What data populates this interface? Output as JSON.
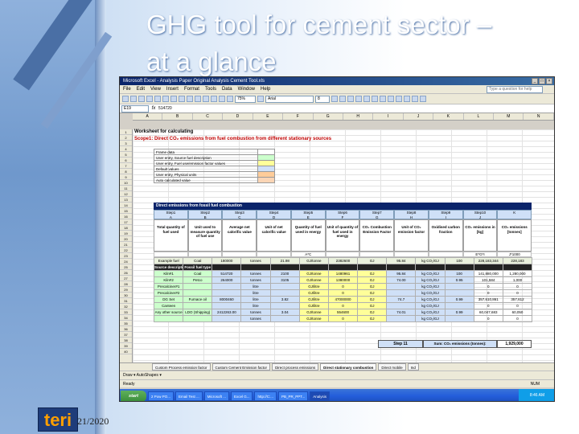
{
  "slide": {
    "title_line1": "GHG tool for cement sector –",
    "title_line2": "at a glance",
    "date": "21/2020",
    "logo_text": "teri"
  },
  "excel": {
    "window_title": "Microsoft Excel - Analysis Paper Original Analysis Cement Tool.xls",
    "menu": [
      "File",
      "Edit",
      "View",
      "Insert",
      "Format",
      "Tools",
      "Data",
      "Window",
      "Help"
    ],
    "help_placeholder": "Type a question for help",
    "zoom": "75%",
    "font": "Arial",
    "font_size": "8",
    "name_box": "E19",
    "formula_value": "514720",
    "columns": [
      "A",
      "B",
      "C",
      "D",
      "E",
      "F",
      "G",
      "H",
      "I",
      "J",
      "K",
      "L",
      "M",
      "N"
    ],
    "rows": [
      "1",
      "2",
      "3",
      "4",
      "5",
      "6",
      "7",
      "8",
      "9",
      "10",
      "11",
      "12",
      "13",
      "14",
      "15",
      "16",
      "17",
      "18",
      "19",
      "20",
      "21",
      "22",
      "23",
      "24",
      "25",
      "26",
      "27",
      "28",
      "29",
      "30",
      "31",
      "32",
      "33",
      "34",
      "35",
      "36",
      "37",
      "38",
      "39",
      "40"
    ],
    "worksheet_title": "Worksheet for calculating",
    "scope_title": "Scope1: Direct CO₂ emissions from fuel combustion from different stationary sources",
    "legend": [
      {
        "label": "Frame data",
        "color": "#ffffff"
      },
      {
        "label": "User entry, Source fuel description",
        "color": "#ccffcc"
      },
      {
        "label": "User entry, Fuel use/emission factor values",
        "color": "#ffff99"
      },
      {
        "label": "Default values",
        "color": "#cfe0f7"
      },
      {
        "label": "User entry, Physical units",
        "color": "#ffcc99"
      },
      {
        "label": "Auto calculated value",
        "color": "#fbd5b5"
      }
    ],
    "table_header": "Direct emissions from fossil fuel combustion",
    "steps": [
      "Step1\nA",
      "Step2\nB",
      "Step3\nC",
      "Step4\nD",
      "Step5\nE",
      "Step6\nF",
      "Step7\nG",
      "Step8\nH",
      "Step9\nI",
      "Step10\nJ",
      "K"
    ],
    "column_heads": [
      "Total quantity of fuel used",
      "Unit used to measure quantity of fuel use",
      "Average net calorific value",
      "Unit of net calorific value",
      "Quantity of fuel used in energy",
      "Unit of quantity of fuel used in energy",
      "CO₂ Combustion Emission Factor",
      "Unit of CO₂ emission factor",
      "Oxidised carbon fraction",
      "CO₂ emissions in [kg]",
      "CO₂ emissions [tonnes]"
    ],
    "units_row": [
      "",
      "",
      "",
      "",
      "A*C",
      "",
      "",
      "",
      "",
      "E*G*I",
      "J*1000"
    ],
    "rows_data": [
      {
        "kind": "example",
        "cells": [
          "Example fuel",
          "Coal",
          "180000",
          "tonnes",
          "21.98",
          "GJ/tonne",
          "2382600",
          "GJ",
          "95.84",
          "kg CO₂/GJ",
          "100",
          "228,183,344",
          "228,183"
        ]
      },
      {
        "kind": "subhdr",
        "cells": [
          "Source description",
          "Fossil fuel type",
          "",
          "",
          "",
          "",
          "",
          "",
          "",
          "",
          "",
          "",
          ""
        ]
      },
      {
        "kind": "data",
        "cells": [
          "Kiln#1",
          "Coal",
          "514720",
          "tonnes",
          "2100",
          "GJ/tonne",
          "1480961",
          "GJ",
          "95.84",
          "kg CO₂/GJ",
          "100",
          "141,880,000",
          "1,280,000"
        ]
      },
      {
        "kind": "data",
        "cells": [
          "Kiln#2",
          "Petco",
          "264000",
          "tonnes",
          "3105",
          "GJ/tonne",
          "1380000",
          "GJ",
          "74.00",
          "kg CO₂/GJ",
          "0.95",
          "101,584",
          "1,000"
        ]
      },
      {
        "kind": "data",
        "cells": [
          "Precalciner#1",
          "",
          "",
          "litre",
          "",
          "GJ/litre",
          "0",
          "GJ",
          "",
          "kg CO₂/GJ",
          "",
          "0",
          "0"
        ]
      },
      {
        "kind": "data",
        "cells": [
          "Precalciner#2",
          "",
          "",
          "litre",
          "",
          "GJ/litre",
          "0",
          "GJ",
          "",
          "kg CO₂/GJ",
          "",
          "0",
          "0"
        ]
      },
      {
        "kind": "data",
        "cells": [
          "DG Set",
          "Furnace oil",
          "8000460",
          "litre",
          "3.82",
          "GJ/litre",
          "47000000",
          "GJ",
          "74.7",
          "kg CO₂/GJ",
          "0.99",
          "357,610,861",
          "357,612"
        ]
      },
      {
        "kind": "data",
        "cells": [
          "Canteen",
          "",
          "",
          "litre",
          "",
          "GJ/litre",
          "0",
          "GJ",
          "",
          "kg CO₂/GJ",
          "",
          "0",
          "0"
        ]
      },
      {
        "kind": "data",
        "cells": [
          "Any other source",
          "LDO (Shipping)",
          "2412263.00",
          "tonnes",
          "3.04",
          "GJ/tonne",
          "554600",
          "GJ",
          "74.01",
          "kg CO₂/GJ",
          "0.99",
          "60,047,683",
          "60,050"
        ]
      },
      {
        "kind": "data",
        "cells": [
          "",
          "",
          "",
          "tonnes",
          "",
          "GJ/tonne",
          "0",
          "GJ",
          "",
          "kg CO₂/GJ",
          "",
          "0",
          "0"
        ]
      }
    ],
    "step11_label": "Step 11",
    "sum_label": "Sum: CO₂ emissions (tonnes):",
    "sum_value": "1,929,000",
    "sheet_tabs": [
      "Custom Process emission factor",
      "Custom Cement Emission factor",
      "Direct process emissions",
      "Direct stationary combustion",
      "Direct mobile",
      "Ind"
    ],
    "active_tab": "Direct stationary combustion",
    "drawing_label": "Draw ▾   AutoShapes ▾",
    "status": "Ready",
    "num_indicator": "NUM",
    "taskbar": {
      "start": "start",
      "tasks": [
        "2 Pow PO...",
        "Email Test ...",
        "Microsoft ...",
        "Excel G...",
        "http://C:...",
        "PB_PR_PPT...",
        "Analysis"
      ],
      "active_task": "Analysis",
      "clock": "8:46 AM"
    }
  }
}
